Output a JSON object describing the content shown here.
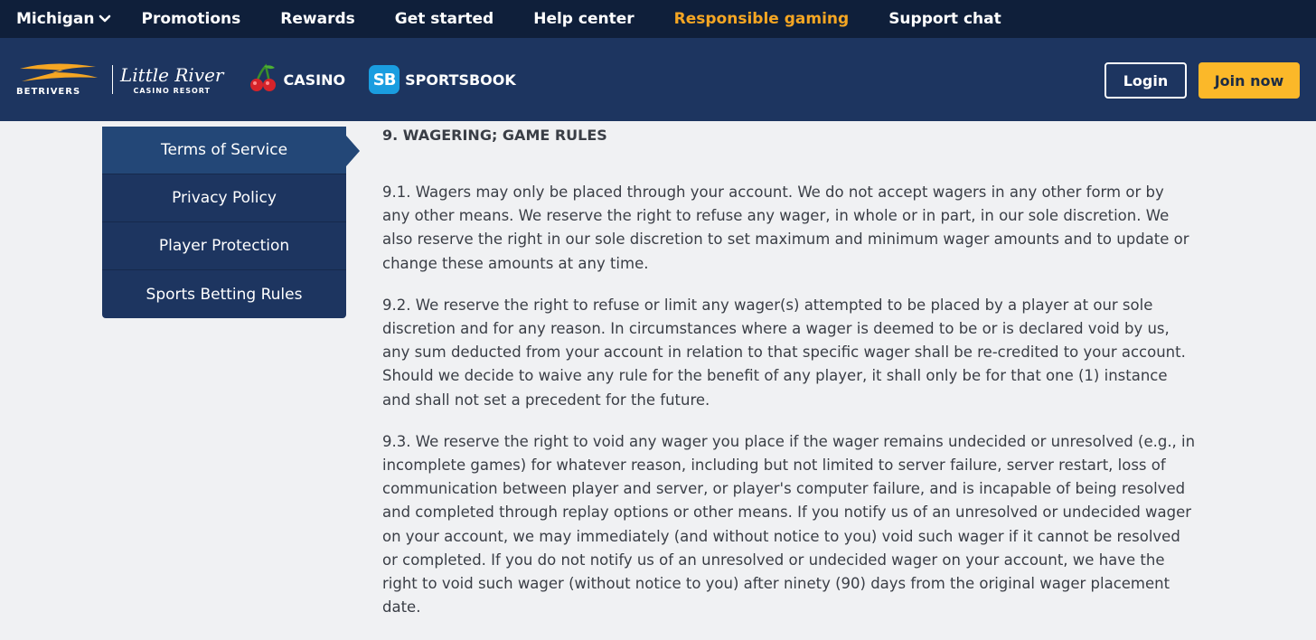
{
  "topbar": {
    "region": "Michigan",
    "region_icon": "chevron-down-icon",
    "links": [
      "Promotions",
      "Rewards",
      "Get started",
      "Help center",
      "Responsible gaming",
      "Support chat"
    ],
    "highlight_color": "#f5a623"
  },
  "header": {
    "betrivers_logo": "BETRIVERS",
    "little_river_name": "Little River",
    "little_river_sub": "CASINO RESORT",
    "casino_label": "CASINO",
    "casino_icon": "cherries-icon",
    "sportsbook_icon_text": "SB",
    "sportsbook_label": "SPORTSBOOK",
    "login_label": "Login",
    "join_label": "Join now"
  },
  "sidebar": {
    "items": [
      "Terms of Service",
      "Privacy Policy",
      "Player Protection",
      "Sports Betting Rules"
    ],
    "active": "Terms of Service"
  },
  "content": {
    "section_title": "9. WAGERING; GAME RULES",
    "paragraphs": [
      "9.1. Wagers may only be placed through your account. We do not accept wagers in any other form or by any other means. We reserve the right to refuse any wager, in whole or in part, in our sole discretion. We also reserve the right in our sole discretion to set maximum and minimum wager amounts and to update or change these amounts at any time.",
      "9.2. We reserve the right to refuse or limit any wager(s) attempted to be placed by a player at our sole discretion and for any reason. In circumstances where a wager is deemed to be or is declared void by us, any sum deducted from your account in relation to that specific wager shall be re-credited to your account. Should we decide to waive any rule for the benefit of any player, it shall only be for that one (1) instance and shall not set a precedent for the future.",
      "9.3. We reserve the right to void any wager you place if the wager remains undecided or unresolved (e.g., in incomplete games) for whatever reason, including but not limited to server failure, server restart, loss of communication between player and server, or player's computer failure, and is incapable of being resolved and completed through replay options or other means. If you notify us of an unresolved or undecided wager on your account, we may immediately (and without notice to you) void such wager if it cannot be resolved or completed. If you do not notify us of an unresolved or undecided wager on your account, we have the right to void such wager (without notice to you) after ninety (90) days from the original wager placement date."
    ]
  },
  "colors": {
    "topbar_bg": "#0f1f3a",
    "header_bg": "#1d3560",
    "accent_gold": "#fbb829",
    "page_bg": "#f0f1f3"
  }
}
